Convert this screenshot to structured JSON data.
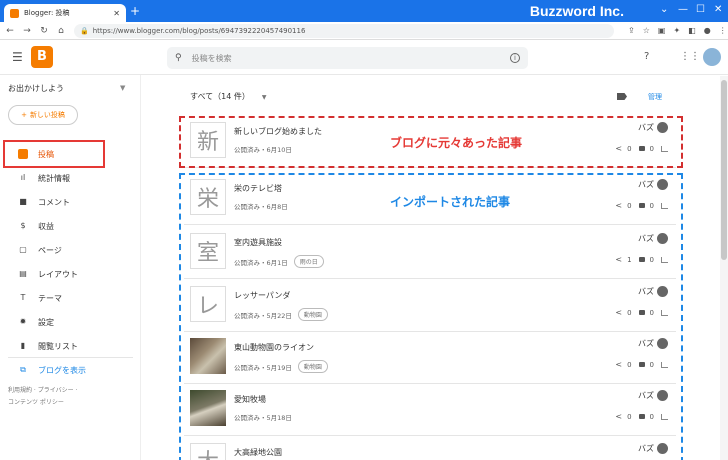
{
  "browser": {
    "tab_title": "Blogger: 投稿",
    "url": "https://www.blogger.com/blog/posts/6947392220457490116",
    "brand_watermark": "Buzzword Inc."
  },
  "header": {
    "search_placeholder": "投稿を検索"
  },
  "sidebar": {
    "blog_name": "お出かけしよう",
    "new_post": "新しい投稿",
    "items": [
      {
        "label": "投稿",
        "icon": "posts-icon"
      },
      {
        "label": "統計情報",
        "icon": "stats-icon"
      },
      {
        "label": "コメント",
        "icon": "comment-icon"
      },
      {
        "label": "収益",
        "icon": "dollar-icon"
      },
      {
        "label": "ページ",
        "icon": "pages-icon"
      },
      {
        "label": "レイアウト",
        "icon": "layout-icon"
      },
      {
        "label": "テーマ",
        "icon": "theme-icon"
      },
      {
        "label": "設定",
        "icon": "gear-icon"
      },
      {
        "label": "閲覧リスト",
        "icon": "bookmark-icon"
      }
    ],
    "view_blog": "ブログを表示",
    "footer_line1": "利用規約 · プライバシー ·",
    "footer_line2": "コンテンツ ポリシー"
  },
  "main": {
    "filter": "すべて（14 件）",
    "manage": "管理",
    "posts": [
      {
        "title": "新しいブログ始めました",
        "meta": "公開済み・6月10日",
        "thumb": "新",
        "author": "バズ",
        "comments": "0"
      },
      {
        "title": "栄のテレビ塔",
        "meta": "公開済み・6月8日",
        "thumb": "栄",
        "author": "バズ",
        "comments": "0"
      },
      {
        "title": "室内遊具施設",
        "meta": "公開済み・6月1日",
        "thumb": "室",
        "label": "雨の日",
        "author": "バズ",
        "comments": "1"
      },
      {
        "title": "レッサーパンダ",
        "meta": "公開済み・5月22日",
        "thumb": "レ",
        "label": "動物園",
        "author": "バズ",
        "comments": "0"
      },
      {
        "title": "東山動物園のライオン",
        "meta": "公開済み・5月19日",
        "thumb": "",
        "label": "動物園",
        "author": "バズ",
        "comments": "0"
      },
      {
        "title": "愛知牧場",
        "meta": "公開済み・5月18日",
        "thumb": "",
        "author": "バズ",
        "comments": "0"
      },
      {
        "title": "大高緑地公園",
        "meta": "",
        "thumb": "大",
        "author": "バズ",
        "comments": ""
      }
    ]
  },
  "annotations": {
    "original": "ブログに元々あった記事",
    "imported": "インポートされた記事"
  }
}
